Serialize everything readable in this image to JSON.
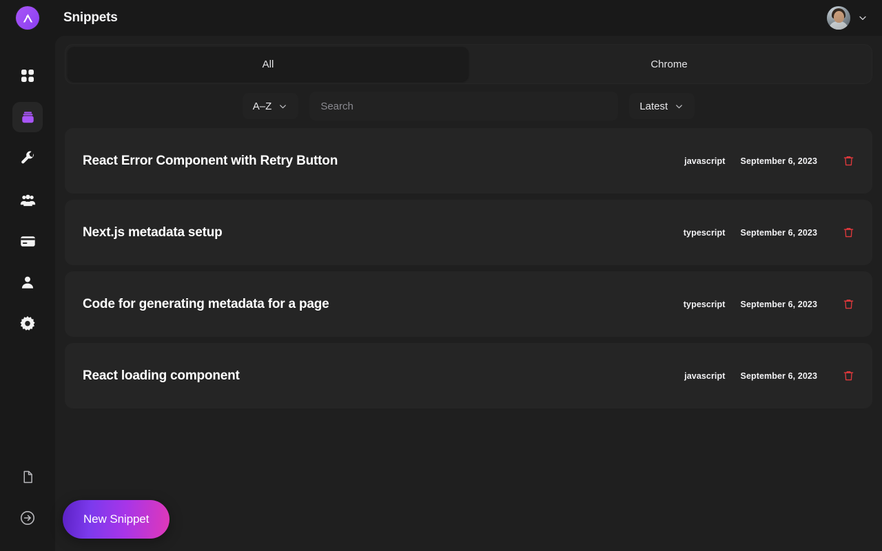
{
  "app": {
    "logo_icon": "app-logo-arrow-icon",
    "title": "Snippets"
  },
  "sidebar": {
    "top_items": [
      {
        "icon": "grid-dashboard-icon",
        "label": "Dashboard",
        "active": false
      },
      {
        "icon": "box-snippets-icon",
        "label": "Snippets",
        "active": true
      },
      {
        "icon": "wrench-tools-icon",
        "label": "Tools",
        "active": false
      },
      {
        "icon": "people-team-icon",
        "label": "Team",
        "active": false
      },
      {
        "icon": "credit-card-billing-icon",
        "label": "Billing",
        "active": false
      },
      {
        "icon": "person-account-icon",
        "label": "Account",
        "active": false
      },
      {
        "icon": "gear-settings-icon",
        "label": "Settings",
        "active": false
      }
    ],
    "bottom_items": [
      {
        "icon": "document-file-icon",
        "label": "Docs"
      },
      {
        "icon": "arrow-right-circle-logout-icon",
        "label": "Log out"
      }
    ]
  },
  "topbar": {
    "title": "Snippets",
    "user_menu_chevron": "chevron-down-icon",
    "avatar": "user-avatar"
  },
  "tabs": [
    {
      "label": "All",
      "active": true
    },
    {
      "label": "Chrome",
      "active": false
    }
  ],
  "filters": {
    "sort": {
      "label": "A–Z",
      "chevron": "chevron-down-icon"
    },
    "search": {
      "value": "",
      "placeholder": "Search"
    },
    "order": {
      "label": "Latest",
      "chevron": "chevron-down-icon"
    }
  },
  "snippets": [
    {
      "title": "React Error Component with Retry Button",
      "language": "javascript",
      "date": "September 6, 2023",
      "delete_icon": "trash-delete-icon"
    },
    {
      "title": "Next.js metadata setup",
      "language": "typescript",
      "date": "September 6, 2023",
      "delete_icon": "trash-delete-icon"
    },
    {
      "title": "Code for generating metadata for a page",
      "language": "typescript",
      "date": "September 6, 2023",
      "delete_icon": "trash-delete-icon"
    },
    {
      "title": "React loading component",
      "language": "javascript",
      "date": "September 6, 2023",
      "delete_icon": "trash-delete-icon"
    }
  ],
  "fab": {
    "label": "New Snippet"
  },
  "colors": {
    "page_background": "#191919",
    "panel_background": "#1f1f1f",
    "row_background": "#252525",
    "control_background": "#222222",
    "accent_purple": "#a855f7",
    "accent_magenta": "#e038b8",
    "delete_red": "#e0393c",
    "text_primary": "#ffffff",
    "text_muted": "#8a8a90"
  }
}
